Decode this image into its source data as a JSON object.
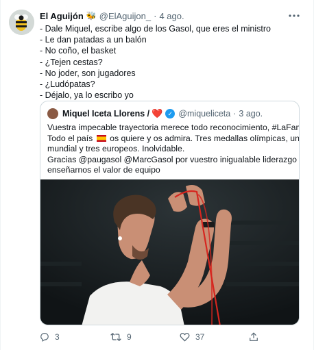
{
  "tweet": {
    "author_name": "El Aguijón",
    "author_emoji": "🐝",
    "handle": "@ElAguijon_",
    "separator": "·",
    "time": "4 ago.",
    "more_icon": "more-icon",
    "lines": [
      "- Dale Miquel, escribe algo de los Gasol, que eres el ministro",
      "- Le dan patadas a un balón",
      "- No coño, el basket",
      "- ¿Tejen cestas?",
      "- No joder, son jugadores",
      "- ¿Ludópatas?",
      "- Déjalo, ya lo escribo yo"
    ]
  },
  "quoted": {
    "author_name": "Miquel Iceta Llorens /",
    "heart": "❤️",
    "verified_icon": "verified-badge-icon",
    "handle": "@miqueliceta",
    "separator": "·",
    "time": "3 ago.",
    "line1": "Vuestra impecable trayectoria merece todo reconocimiento, #LaFamilia.",
    "line2_pre": "Todo el país",
    "flag_icon": "spain-flag-icon",
    "line2_post": "os quiere y os admira. Tres medallas olímpicas, un",
    "line3": "mundial y tres europeos. Inolvidable.",
    "line4": "Gracias @paugasol @MarcGasol por vuestro inigualable liderazgo y por",
    "line5": "enseñarnos el valor de equipo"
  },
  "actions": {
    "replies": "3",
    "retweets": "9",
    "likes": "37"
  },
  "colors": {
    "text": "#0f1419",
    "secondary": "#536471",
    "verified": "#1d9bf0",
    "heart": "#e0245e",
    "border": "#cfd9de"
  }
}
